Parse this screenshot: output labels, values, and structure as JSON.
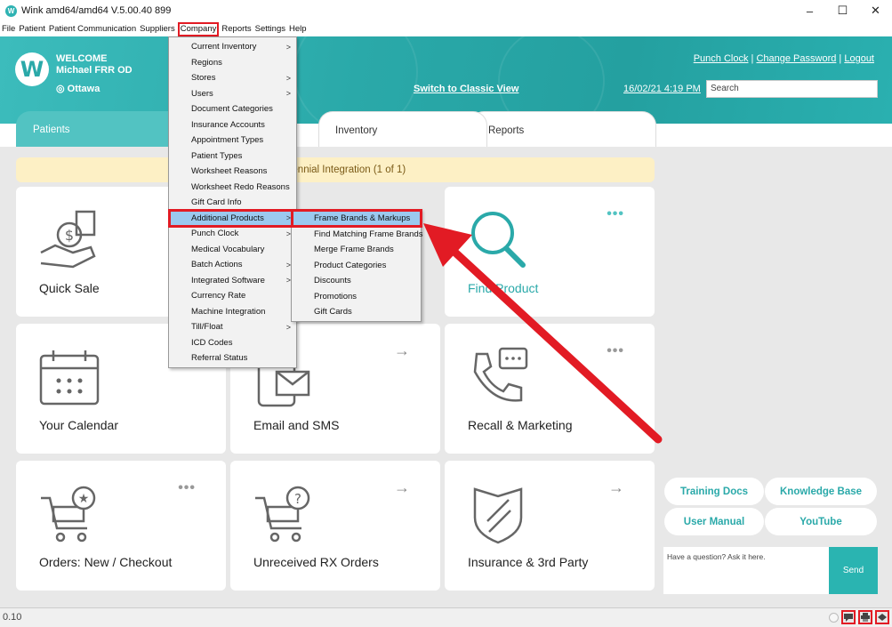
{
  "window": {
    "title": "Wink amd64/amd64 V.5.00.40 899",
    "minimize": "–",
    "maximize": "☐",
    "close": "✕"
  },
  "menubar": [
    "File",
    "Patient",
    "Patient Communication",
    "Suppliers",
    "Company",
    "Reports",
    "Settings",
    "Help"
  ],
  "header": {
    "welcome": "WELCOME",
    "user": "Michael FRR OD",
    "location": "Ottawa",
    "switch_view": "Switch to Classic View",
    "punch_clock": "Punch Clock",
    "change_password": "Change Password",
    "logout": "Logout",
    "separator": "|",
    "datetime": "16/02/21 4:19 PM",
    "search_placeholder": "Search"
  },
  "tabs": {
    "patients": "Patients",
    "inventory": "Inventory",
    "reports": "Reports"
  },
  "banner": ": Centennial Integration (1 of 1)",
  "tiles": {
    "quick_sale": "Quick Sale",
    "find_product": "Find Product",
    "calendar": "Your Calendar",
    "email_sms": "Email and SMS",
    "recall": "Recall & Marketing",
    "orders": "Orders: New / Checkout",
    "unreceived": "Unreceived RX Orders",
    "insurance": "Insurance & 3rd Party",
    "dots": "•••",
    "arrow": "→"
  },
  "help": {
    "training_docs": "Training Docs",
    "knowledge_base": "Knowledge Base",
    "user_manual": "User Manual",
    "youtube": "YouTube",
    "ask_placeholder": "Have a question? Ask it here.",
    "send": "Send"
  },
  "status": {
    "version": "0.10"
  },
  "company_menu": [
    {
      "label": "Current Inventory",
      "sub": true
    },
    {
      "label": "Regions",
      "sub": false
    },
    {
      "label": "Stores",
      "sub": true
    },
    {
      "label": "Users",
      "sub": true
    },
    {
      "label": "Document Categories",
      "sub": false
    },
    {
      "label": "Insurance Accounts",
      "sub": false
    },
    {
      "label": "Appointment Types",
      "sub": false
    },
    {
      "label": "Patient Types",
      "sub": false
    },
    {
      "label": "Worksheet Reasons",
      "sub": false
    },
    {
      "label": "Worksheet Redo Reasons",
      "sub": false
    },
    {
      "label": "Gift Card Info",
      "sub": false
    },
    {
      "label": "Additional Products",
      "sub": true
    },
    {
      "label": "Punch Clock",
      "sub": true
    },
    {
      "label": "Medical Vocabulary",
      "sub": false
    },
    {
      "label": "Batch Actions",
      "sub": true
    },
    {
      "label": "Integrated Software",
      "sub": true
    },
    {
      "label": "Currency Rate",
      "sub": false
    },
    {
      "label": "Machine Integration",
      "sub": false
    },
    {
      "label": "Till/Float",
      "sub": true
    },
    {
      "label": "ICD Codes",
      "sub": false
    },
    {
      "label": "Referral Status",
      "sub": false
    }
  ],
  "additional_products_menu": [
    "Frame Brands & Markups",
    "Find Matching Frame Brands",
    "Merge Frame Brands",
    "Product Categories",
    "Discounts",
    "Promotions",
    "Gift Cards"
  ],
  "colors": {
    "teal": "#2aa9a9",
    "highlight": "#e21b24",
    "menu_selected": "#9bc9ef"
  }
}
